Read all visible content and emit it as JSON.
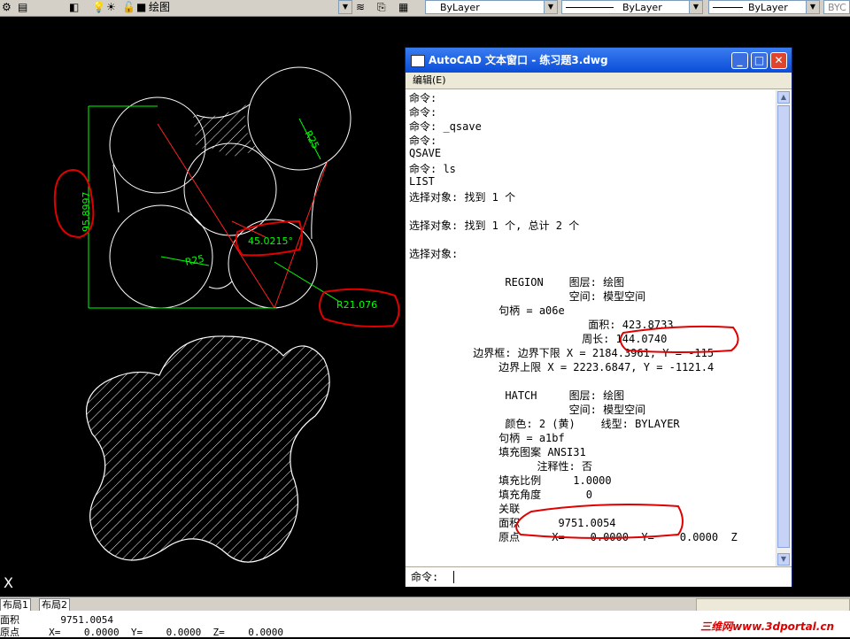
{
  "toolbar": {
    "layer_name": "绘图",
    "color_value": "ByLayer",
    "linetype_value": "ByLayer",
    "lineweight_value": "ByLayer",
    "plotstyle_value": "BYC"
  },
  "drawing": {
    "dim_vertical": "95.8997",
    "radius_top": "R25",
    "radius_left": "R25",
    "angle": "45.0215°",
    "radius_leader": "R21.076"
  },
  "text_window": {
    "title": "AutoCAD 文本窗口 - 练习题3.dwg",
    "menu_edit": "编辑(E)",
    "lines": [
      "命令:",
      "命令:",
      "命令: _qsave",
      "命令:",
      "QSAVE",
      "命令: ls",
      "LIST",
      "选择对象: 找到 1 个",
      "",
      "选择对象: 找到 1 个, 总计 2 个",
      "",
      "选择对象:",
      "",
      "               REGION    图层: 绘图",
      "                         空间: 模型空间",
      "              句柄 = a06e",
      "                            面积: 423.8733",
      "                           周长: 144.0740",
      "          边界框: 边界下限 X = 2184.3961, Y = -115",
      "              边界上限 X = 2223.6847, Y = -1121.4",
      "",
      "               HATCH     图层: 绘图",
      "                         空间: 模型空间",
      "               颜色: 2 (黄)    线型: BYLAYER",
      "              句柄 = a1bf",
      "              填充图案 ANSI31",
      "                    注释性: 否",
      "              填充比例     1.0000",
      "              填充角度       0",
      "              关联",
      "              面积      9751.0054",
      "              原点     X=    0.0000  Y=    0.0000  Z"
    ],
    "prompt": "命令:"
  },
  "layout_tabs": [
    "布局1",
    "布局2"
  ],
  "command_line": [
    "面积       9751.0054",
    "原点     X=    0.0000  Y=    0.0000  Z=    0.0000"
  ],
  "watermark": "三维网www.3dportal.cn",
  "colors": {
    "dimension": "#00ff00",
    "construction": "#ff0000",
    "annotation_ink": "#e00000",
    "geometry": "#ffffff"
  }
}
